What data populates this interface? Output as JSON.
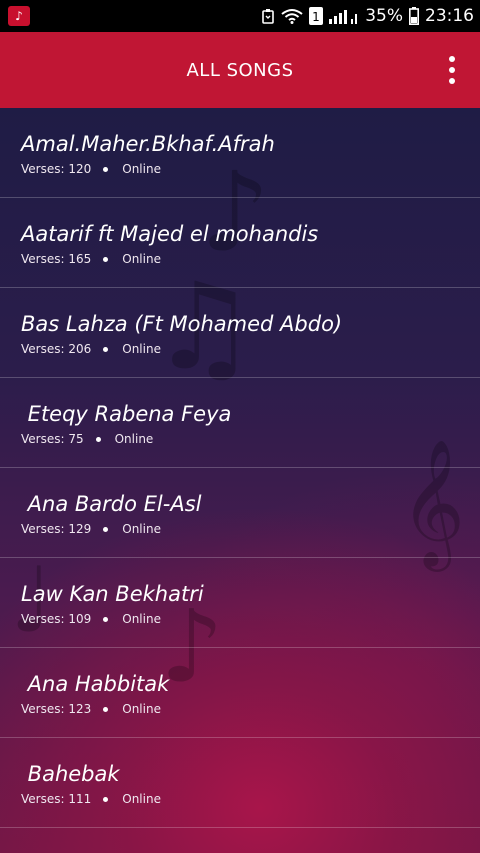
{
  "status_bar": {
    "battery_percent": "35%",
    "time": "23:16",
    "sim_slot": "1",
    "icons": [
      "notification-app-icon",
      "nfc-icon",
      "wifi-icon",
      "sim-icon",
      "signal-icon",
      "battery-icon"
    ]
  },
  "app_bar": {
    "title": "ALL SONGS",
    "menu_icon": "overflow-menu-icon",
    "background": "#c01634"
  },
  "songs": [
    {
      "title": "Amal.Maher.Bkhaf.Afrah",
      "verses": "Verses: 120",
      "status": "Online"
    },
    {
      "title": "Aatarif ft Majed el mohandis",
      "verses": "Verses: 165",
      "status": "Online"
    },
    {
      "title": "Bas Lahza (Ft Mohamed Abdo)",
      "verses": "Verses: 206",
      "status": "Online"
    },
    {
      "title": " Eteqy Rabena Feya",
      "verses": "Verses: 75",
      "status": "Online"
    },
    {
      "title": " Ana Bardo El-Asl",
      "verses": "Verses: 129",
      "status": "Online"
    },
    {
      "title": "Law Kan Bekhatri",
      "verses": "Verses: 109",
      "status": "Online"
    },
    {
      "title": " Ana Habbitak",
      "verses": "Verses: 123",
      "status": "Online"
    },
    {
      "title": " Bahebak",
      "verses": "Verses: 111",
      "status": "Online"
    }
  ]
}
